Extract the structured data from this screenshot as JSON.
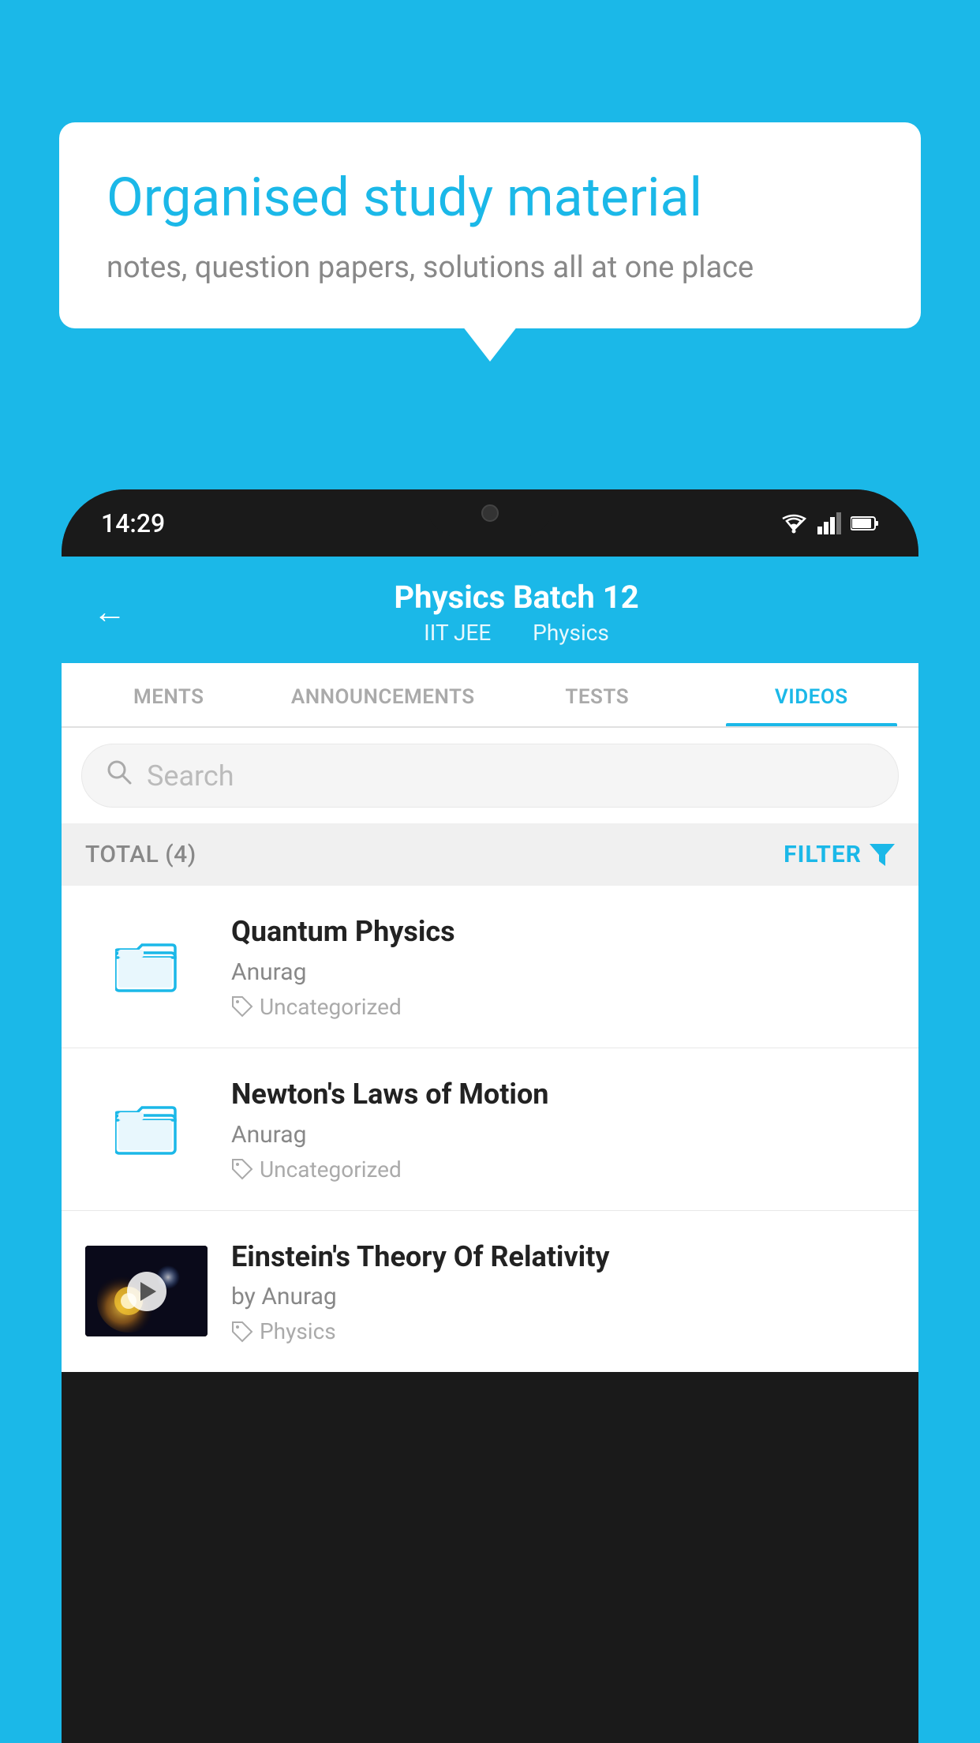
{
  "background": {
    "color": "#1bb8e8"
  },
  "speech_bubble": {
    "title": "Organised study material",
    "subtitle": "notes, question papers, solutions all at one place"
  },
  "phone": {
    "status_bar": {
      "time": "14:29",
      "wifi": "▾",
      "signal": "▲",
      "battery": "▮"
    },
    "header": {
      "back_label": "←",
      "title": "Physics Batch 12",
      "subtitle_part1": "IIT JEE",
      "subtitle_part2": "Physics"
    },
    "tabs": [
      {
        "label": "MENTS",
        "active": false
      },
      {
        "label": "ANNOUNCEMENTS",
        "active": false
      },
      {
        "label": "TESTS",
        "active": false
      },
      {
        "label": "VIDEOS",
        "active": true
      }
    ],
    "search": {
      "placeholder": "Search"
    },
    "filter_row": {
      "total_label": "TOTAL (4)",
      "filter_label": "FILTER"
    },
    "videos": [
      {
        "id": 1,
        "title": "Quantum Physics",
        "author": "Anurag",
        "tag": "Uncategorized",
        "has_thumb": false
      },
      {
        "id": 2,
        "title": "Newton's Laws of Motion",
        "author": "Anurag",
        "tag": "Uncategorized",
        "has_thumb": false
      },
      {
        "id": 3,
        "title": "Einstein's Theory Of Relativity",
        "author": "by Anurag",
        "tag": "Physics",
        "has_thumb": true
      }
    ]
  }
}
